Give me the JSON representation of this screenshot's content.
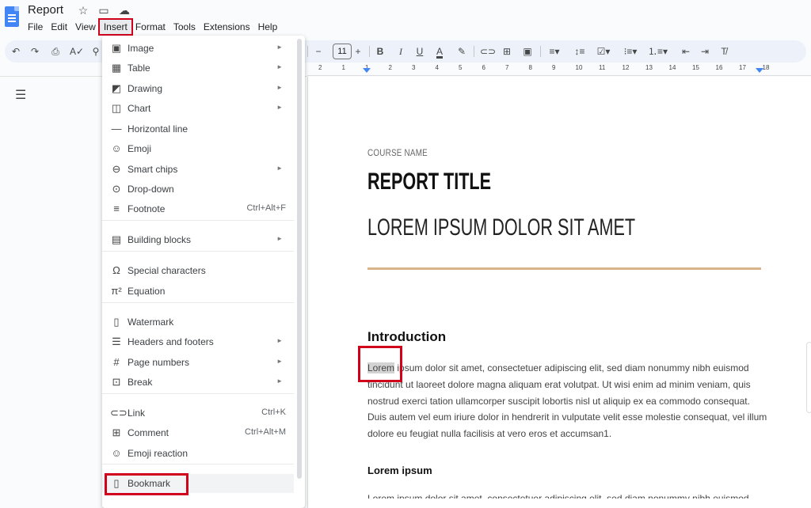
{
  "app": {
    "title": "Report",
    "title_icons": [
      "star-icon",
      "move-to-folder-icon",
      "cloud-status-icon"
    ]
  },
  "menubar": [
    {
      "label": "File"
    },
    {
      "label": "Edit"
    },
    {
      "label": "View"
    },
    {
      "label": "Insert",
      "active": true
    },
    {
      "label": "Format"
    },
    {
      "label": "Tools"
    },
    {
      "label": "Extensions"
    },
    {
      "label": "Help"
    }
  ],
  "toolbar": {
    "font_size": "11",
    "decrease_label": "−",
    "increase_label": "+",
    "bold": "B",
    "italic": "I",
    "underline": "U",
    "text_color": "A"
  },
  "ruler": {
    "ticks": [
      "2",
      "1",
      "1",
      "2",
      "3",
      "4",
      "5",
      "6",
      "7",
      "8",
      "9",
      "10",
      "11",
      "12",
      "13",
      "14",
      "15",
      "16",
      "17",
      "18"
    ]
  },
  "insert_menu": {
    "items": [
      {
        "label": "Image",
        "icon": "image-icon",
        "glyph": "▣",
        "submenu": true
      },
      {
        "label": "Table",
        "icon": "table-icon",
        "glyph": "▦",
        "submenu": true
      },
      {
        "label": "Drawing",
        "icon": "drawing-icon",
        "glyph": "◩",
        "submenu": true
      },
      {
        "label": "Chart",
        "icon": "chart-icon",
        "glyph": "◫",
        "submenu": true
      },
      {
        "label": "Horizontal line",
        "icon": "horizontal-line-icon",
        "glyph": "—",
        "submenu": false
      },
      {
        "label": "Emoji",
        "icon": "emoji-icon",
        "glyph": "☺",
        "submenu": false
      },
      {
        "label": "Smart chips",
        "icon": "smart-chips-icon",
        "glyph": "⊖",
        "submenu": true
      },
      {
        "label": "Drop-down",
        "icon": "dropdown-icon",
        "glyph": "⊙",
        "submenu": false
      },
      {
        "label": "Footnote",
        "icon": "footnote-icon",
        "glyph": "≡",
        "shortcut": "Ctrl+Alt+F",
        "submenu": false
      },
      {
        "label": "Building blocks",
        "icon": "building-blocks-icon",
        "glyph": "▤",
        "submenu": true
      },
      {
        "label": "Special characters",
        "icon": "omega-icon",
        "glyph": "Ω",
        "submenu": false
      },
      {
        "label": "Equation",
        "icon": "pi-icon",
        "glyph": "π²",
        "submenu": false
      },
      {
        "label": "Watermark",
        "icon": "watermark-icon",
        "glyph": "▯",
        "submenu": false
      },
      {
        "label": "Headers and footers",
        "icon": "headers-footers-icon",
        "glyph": "☰",
        "submenu": true
      },
      {
        "label": "Page numbers",
        "icon": "hash-icon",
        "glyph": "#",
        "submenu": true
      },
      {
        "label": "Break",
        "icon": "break-icon",
        "glyph": "⊡",
        "submenu": true
      },
      {
        "label": "Link",
        "icon": "link-icon",
        "glyph": "⊂⊃",
        "shortcut": "Ctrl+K",
        "submenu": false
      },
      {
        "label": "Comment",
        "icon": "comment-icon",
        "glyph": "⊞",
        "shortcut": "Ctrl+Alt+M",
        "submenu": false
      },
      {
        "label": "Emoji reaction",
        "icon": "emoji-reaction-icon",
        "glyph": "☺",
        "submenu": false
      },
      {
        "label": "Bookmark",
        "icon": "bookmark-icon",
        "glyph": "▯",
        "submenu": false,
        "highlighted": true
      }
    ]
  },
  "document": {
    "course_name": "COURSE NAME",
    "report_title": "REPORT TITLE",
    "subtitle": "LOREM IPSUM DOLOR SIT AMET",
    "accent_color": "#d9b38c",
    "heading1": "Introduction",
    "selected_word": "Lorem",
    "paragraph1_rest": " ipsum dolor sit amet, consectetuer adipiscing elit, sed diam nonummy nibh euismod tincidunt ut laoreet dolore magna aliquam erat volutpat. Ut wisi enim ad minim veniam, quis nostrud exerci tation ullamcorper suscipit lobortis nisl ut aliquip ex ea commodo consequat. Duis autem vel eum iriure dolor in hendrerit in vulputate velit esse molestie consequat, vel illum dolore eu feugiat nulla facilisis at vero eros et accumsan1.",
    "heading2": "Lorem ipsum",
    "paragraph2": "Lorem ipsum dolor sit amet, consectetuer adipiscing elit, sed diam nonummy nibh euismod"
  },
  "annotation_color": "#d0021b"
}
